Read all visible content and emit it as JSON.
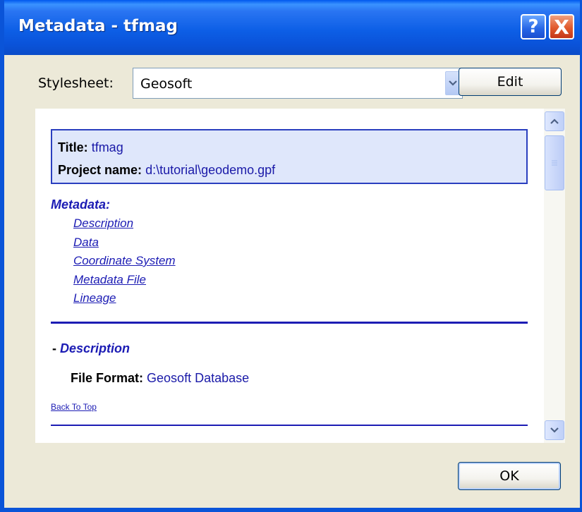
{
  "window": {
    "title": "Metadata - tfmag",
    "help_label": "?",
    "close_label": "X"
  },
  "toolbar": {
    "stylesheet_label": "Stylesheet:",
    "stylesheet_value": "Geosoft",
    "edit_label": "Edit"
  },
  "document": {
    "title_key": "Title:",
    "title_value": "tfmag",
    "project_key": "Project name:",
    "project_value": "d:\\tutorial\\geodemo.gpf",
    "metadata_heading": "Metadata:",
    "links": [
      "Description",
      "Data",
      "Coordinate System",
      "Metadata File",
      "Lineage"
    ],
    "section_prefix": "- ",
    "section_title": "Description",
    "file_format_key": "File Format:",
    "file_format_value": "Geosoft Database",
    "back_to_top": "Back To Top"
  },
  "footer": {
    "ok_label": "OK"
  },
  "colors": {
    "titlebar": "#0a54d8",
    "link": "#1c1cb4",
    "info_box_bg": "#dfe7fb",
    "dialog_bg": "#ece9d8"
  },
  "icons": {
    "dropdown": "chevron-down-icon",
    "scroll_up": "chevron-up-icon",
    "scroll_down": "chevron-down-icon"
  }
}
